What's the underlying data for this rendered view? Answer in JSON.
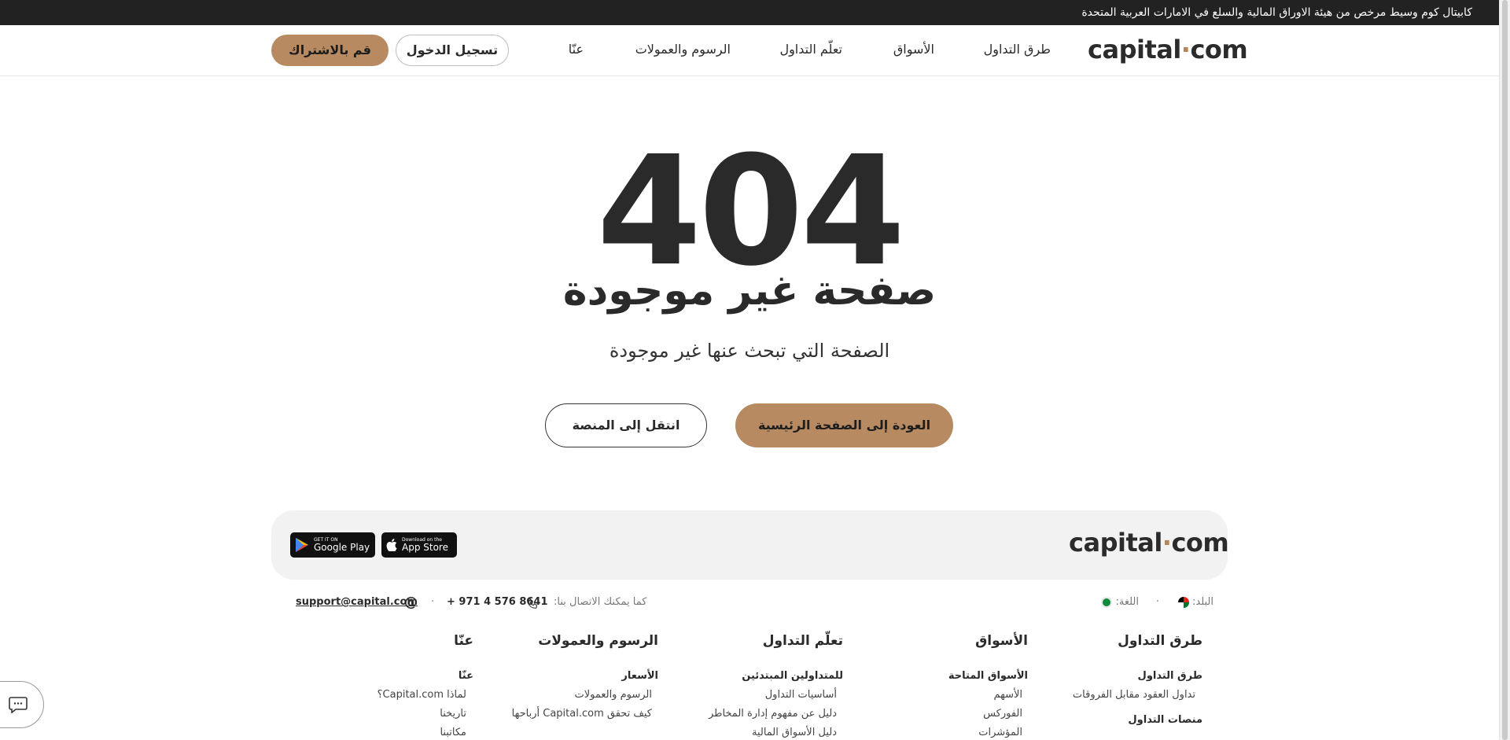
{
  "topbar": {
    "notice": "كابيتال كوم وسيط مرخص من هيئة الاوراق المالية والسلع في الامارات العربية المتحدة"
  },
  "header": {
    "logo_main": "capital",
    "logo_dot": "·",
    "logo_tld": "com",
    "nav": [
      "طرق التداول",
      "الأسواق",
      "تعلّم التداول",
      "الرسوم والعمولات",
      "عنّا"
    ],
    "login_label": "تسجيل الدخول",
    "signup_label": "قم بالاشتراك"
  },
  "error": {
    "code": "404",
    "title": "صفحة غير موجودة",
    "description": "الصفحة التي تبحث عنها غير موجودة",
    "home_button": "العودة إلى الصفحة الرئيسية",
    "platform_button": "انتقل إلى المنصة"
  },
  "footer": {
    "logo_main": "capital",
    "logo_dot": "·",
    "logo_tld": "com",
    "app_store": {
      "small": "Download on the",
      "big": "App Store"
    },
    "google_play": {
      "small": "GET IT ON",
      "big": "Google Play"
    },
    "country_label": "البلد:",
    "language_label": "اللغة:",
    "contact_label": "كما يمكنك الاتصال بنا:",
    "phone": "+ 971 4 576 8641",
    "email": "support@capital.com",
    "columns": [
      {
        "heading": "طرق التداول",
        "sub1": "طرق التداول",
        "links": [
          "تداول العقود مقابل الفروقات"
        ],
        "sub2": "منصات التداول"
      },
      {
        "heading": "الأسواق",
        "sub1": "الأسواق المتاحة",
        "links": [
          "الأسهم",
          "الفوركس",
          "المؤشرات"
        ]
      },
      {
        "heading": "تعلّم التداول",
        "sub1": "للمتداولين المبتدئين",
        "links": [
          "أساسيات التداول",
          "دليل عن مفهوم إدارة المخاطر",
          "دليل الأسواق المالية"
        ]
      },
      {
        "heading": "الرسوم والعمولات",
        "sub1": "الأسعار",
        "links": [
          "الرسوم والعمولات",
          "كيف تحقق Capital.com أرباحها"
        ]
      },
      {
        "heading": "عنّا",
        "sub1": "عنّا",
        "links": [
          "لماذا Capital.com؟",
          "تاريخنا",
          "مكاتبنا"
        ]
      }
    ]
  },
  "colors": {
    "accent": "#b78a61",
    "topbar": "#222222",
    "text": "#2a2a2a"
  }
}
